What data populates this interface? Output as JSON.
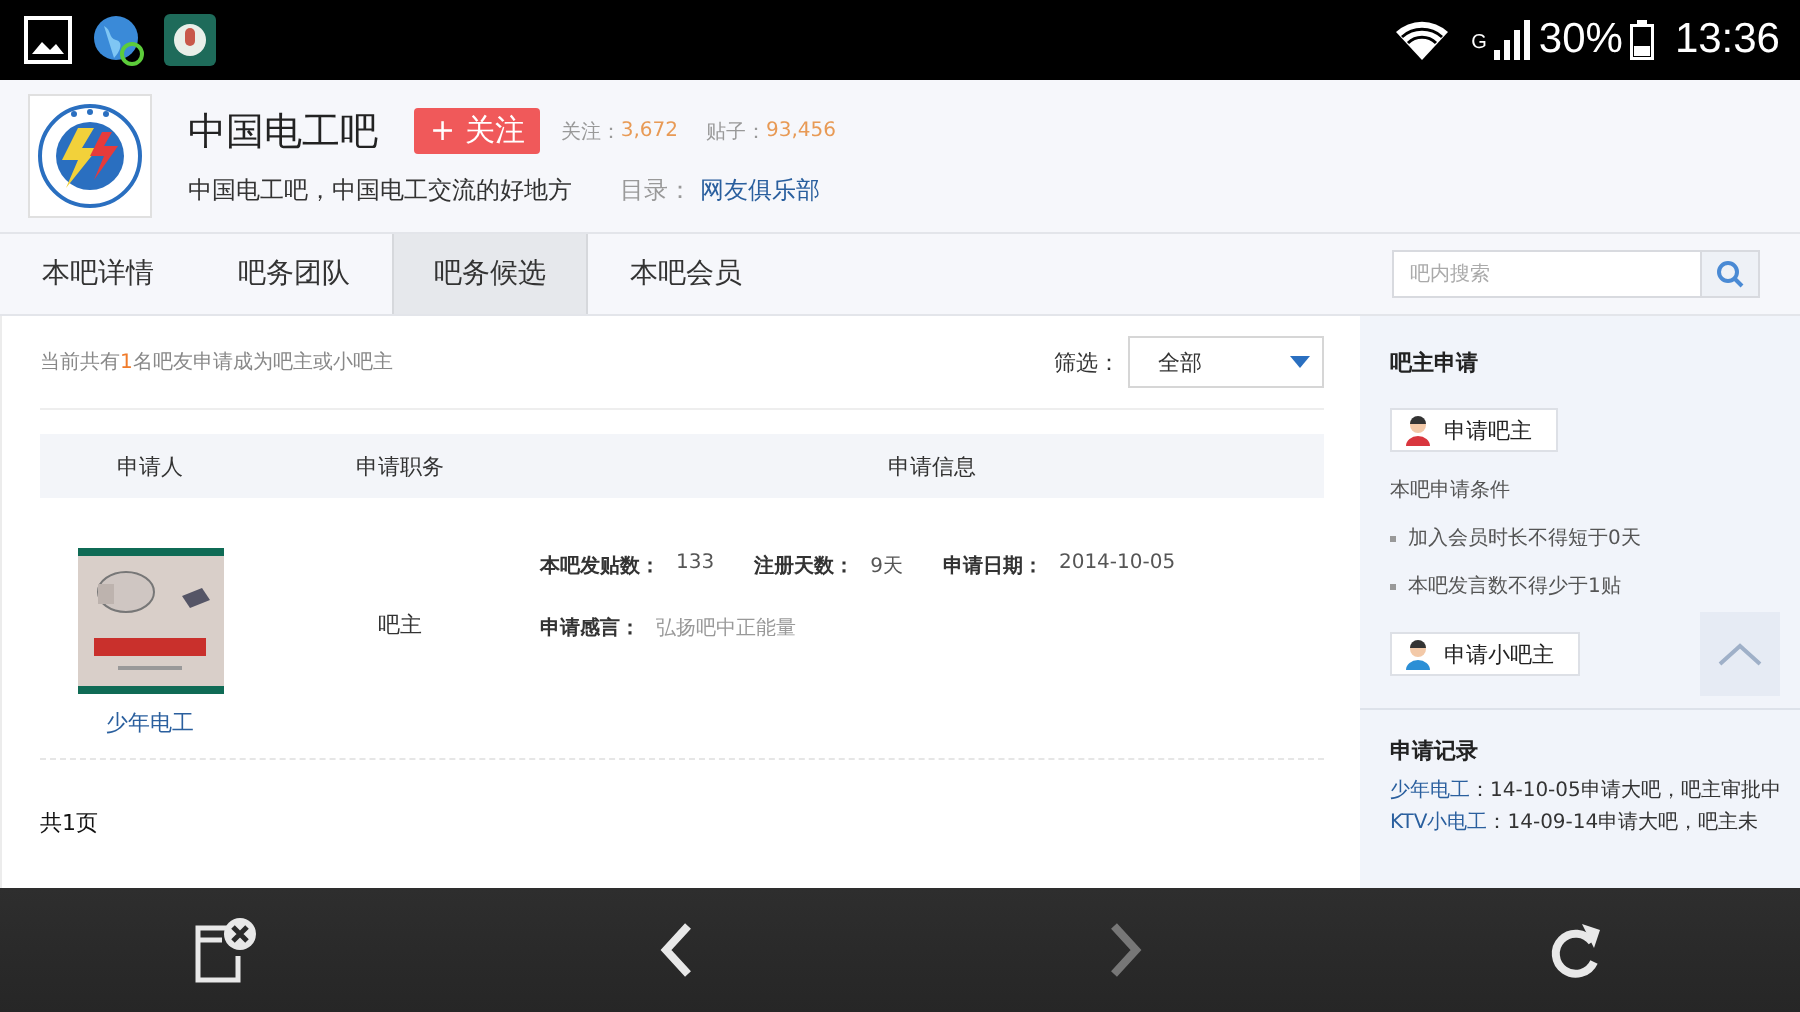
{
  "status_bar": {
    "network": "G",
    "battery": "30%",
    "time": "13:36"
  },
  "forum": {
    "name": "中国电工吧",
    "follow_button": "+ 关注",
    "followers_label": "关注：",
    "followers": "3,672",
    "posts_label": "贴子：",
    "posts": "93,456",
    "slogan": "中国电工吧，中国电工交流的好地方",
    "directory_label": "目录：",
    "directory": "网友俱乐部"
  },
  "tabs": [
    {
      "label": "本吧详情",
      "selected": false
    },
    {
      "label": "吧务团队",
      "selected": false
    },
    {
      "label": "吧务候选",
      "selected": true
    },
    {
      "label": "本吧会员",
      "selected": false
    }
  ],
  "search": {
    "placeholder": "吧内搜索"
  },
  "notice": "当前共有**1**名吧友申请成为吧主或小吧主",
  "filter": {
    "label": "筛选：",
    "value": "全部"
  },
  "table": {
    "columns": [
      "申请人",
      "申请职务",
      "申请信息"
    ],
    "rows": [
      {
        "name": "少年电工",
        "role": "吧主",
        "info": [
          {
            "label": "本吧发贴数：",
            "value": "133"
          },
          {
            "label": "注册天数：",
            "value": "9天"
          },
          {
            "label": "申请日期：",
            "value": "2014-10-05"
          },
          {
            "label": "申请感言：",
            "value": "弘扬吧中正能量"
          }
        ]
      }
    ]
  },
  "pagination": "共1页",
  "sidebar": {
    "title": "吧主申请",
    "apply_owner": "申请吧主",
    "conditions_title": "本吧申请条件",
    "conditions": [
      "加入会员时长不得短于0天",
      "本吧发言数不得少于1贴"
    ],
    "apply_assistant": "申请小吧主",
    "records_title": "申请记录",
    "records": [
      {
        "user": "少年电工",
        "text": "：14-10-05申请大吧，吧主审批中"
      },
      {
        "user": "KTV小电工",
        "text": "：14-09-14申请大吧，吧主未"
      }
    ]
  },
  "toolbar": [
    {
      "kind": "close-tab",
      "disabled": false
    },
    {
      "kind": "back",
      "disabled": false
    },
    {
      "kind": "forward",
      "disabled": true
    },
    {
      "kind": "reload",
      "disabled": false
    }
  ]
}
